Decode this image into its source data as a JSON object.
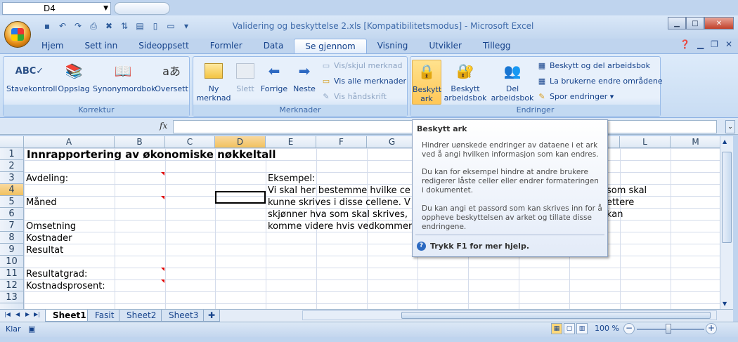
{
  "title": "Validering og beskyttelse 2.xls  [Kompatibilitetsmodus]  -  Microsoft Excel",
  "window_buttons": {
    "minimize": "▁",
    "maximize": "□",
    "close": "✕"
  },
  "tabs": [
    "Hjem",
    "Sett inn",
    "Sideoppsett",
    "Formler",
    "Data",
    "Se gjennom",
    "Visning",
    "Utvikler",
    "Tillegg"
  ],
  "active_tab": "Se gjennom",
  "ribbon": {
    "korrektur": {
      "label": "Korrektur",
      "stavekontroll": "Stavekontroll",
      "oppslag": "Oppslag",
      "synonymordbok": "Synonymordbok",
      "oversett": "Oversett"
    },
    "merknader": {
      "label": "Merknader",
      "ny1": "Ny",
      "ny2": "merknad",
      "slett": "Slett",
      "forrige": "Forrige",
      "neste": "Neste",
      "vis_skjul": "Vis/skjul merknad",
      "vis_alle": "Vis alle merknader",
      "vis_handskrift": "Vis håndskrift"
    },
    "endringer": {
      "label": "Endringer",
      "beskytt_ark1": "Beskytt",
      "beskytt_ark2": "ark",
      "beskytt_arb1": "Beskytt",
      "beskytt_arb2": "arbeidsbok ▾",
      "del1": "Del",
      "del2": "arbeidsbok",
      "beskytt_del": "Beskytt og del arbeidsbok",
      "la_brukerne": "La brukerne endre områdene",
      "spor": "Spor endringer ▾"
    }
  },
  "namebox": "D4",
  "fx": "fx",
  "formula": "",
  "columns": [
    "A",
    "B",
    "C",
    "D",
    "E",
    "F",
    "G",
    "H",
    "I",
    "J",
    "K",
    "L",
    "M"
  ],
  "selected_column": "D",
  "rows": [
    "1",
    "2",
    "3",
    "4",
    "5",
    "6",
    "7",
    "8",
    "9",
    "10",
    "11",
    "12",
    "13"
  ],
  "selected_row": "4",
  "cells": {
    "a1": "Innrapportering av økonomiske nøkkeltall",
    "a3": "Avdeling:",
    "a5": "Måned",
    "a7": "Omsetning",
    "a8": "Kostnader",
    "a9": "Resultat",
    "a11": "Resultatgrad:",
    "a12": "Kostnadsprosent:",
    "e3": "Eksempel:",
    "e4": "Vi skal her bestemme hvilke ce",
    "e5": "kunne skrives i disse cellene. V",
    "e6": "skjønner hva som skal skrives,",
    "e7": "komme videre hvis vedkommen",
    "k4": "som skal",
    "k5": "ettere",
    "k6": "kan"
  },
  "sheets": [
    "Sheet1",
    "Fasit",
    "Sheet2",
    "Sheet3"
  ],
  "active_sheet": "Sheet1",
  "status": "Klar",
  "zoom": "100 %",
  "tooltip": {
    "title": "Beskytt ark",
    "p1": "Hindrer uønskede endringer av dataene i et ark ved å angi hvilken informasjon som kan endres.",
    "p2": "Du kan for eksempel hindre at andre brukere redigerer låste celler eller endrer formateringen i dokumentet.",
    "p3": "Du kan angi et passord som kan skrives inn for å oppheve beskyttelsen av arket og tillate disse endringene.",
    "help": "Trykk F1 for mer hjelp."
  }
}
